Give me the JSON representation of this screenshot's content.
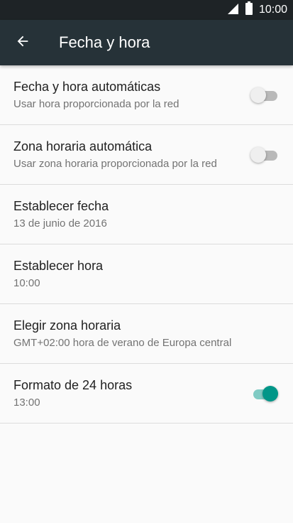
{
  "status_bar": {
    "time": "10:00",
    "icons": [
      "signal-icon",
      "battery-icon"
    ]
  },
  "app_bar": {
    "back_icon": "arrow-back-icon",
    "title": "Fecha y hora"
  },
  "settings": [
    {
      "title": "Fecha y hora automáticas",
      "subtitle": "Usar hora proporcionada por la red",
      "toggle": false
    },
    {
      "title": "Zona horaria automática",
      "subtitle": "Usar zona horaria proporcionada por la red",
      "toggle": false
    },
    {
      "title": "Establecer fecha",
      "subtitle": "13 de junio de 2016"
    },
    {
      "title": "Establecer hora",
      "subtitle": "10:00"
    },
    {
      "title": "Elegir zona horaria",
      "subtitle": "GMT+02:00 hora de verano de Europa central"
    },
    {
      "title": "Formato de 24 horas",
      "subtitle": "13:00",
      "toggle": true
    }
  ],
  "colors": {
    "app_bar": "#263238",
    "status_bar": "#1e2326",
    "accent": "#009688",
    "background": "#fafafa"
  }
}
